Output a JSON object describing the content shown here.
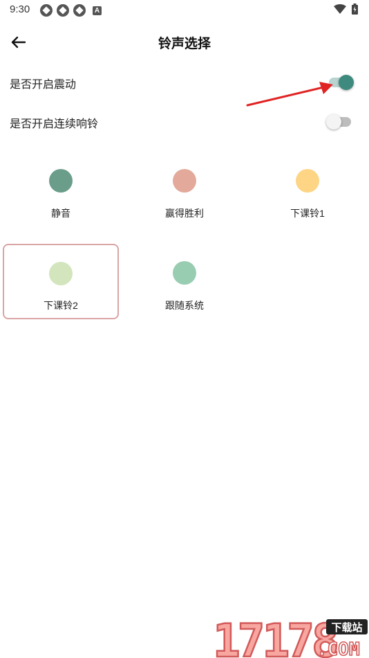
{
  "status_bar": {
    "time": "9:30"
  },
  "header": {
    "title": "铃声选择"
  },
  "settings": [
    {
      "label": "是否开启震动",
      "enabled": true
    },
    {
      "label": "是否开启连续响铃",
      "enabled": false
    }
  ],
  "ringtones": [
    {
      "label": "静音",
      "color": "#6a9d8a",
      "selected": false
    },
    {
      "label": "赢得胜利",
      "color": "#e3a99a",
      "selected": false
    },
    {
      "label": "下课铃1",
      "color": "#fdd585",
      "selected": false
    },
    {
      "label": "下课铃2",
      "color": "#d3e5bd",
      "selected": true
    },
    {
      "label": "跟随系统",
      "color": "#98cdb2",
      "selected": false
    }
  ],
  "annotation": {
    "arrow_color": "#e02424"
  },
  "watermark": {
    "brand_number": "17178",
    "badge_text": "下载站",
    "domain": ".COM"
  },
  "colors": {
    "accent": "#3e8a7e",
    "selected_border": "#d9a4a4"
  }
}
